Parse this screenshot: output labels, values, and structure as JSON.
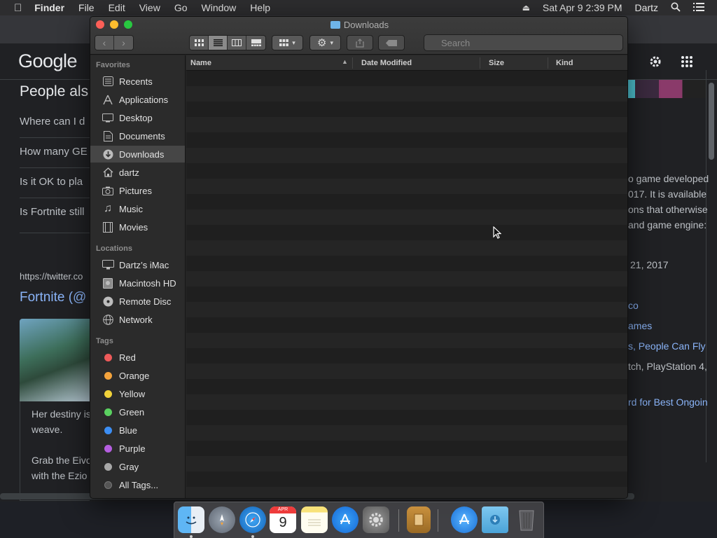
{
  "menubar": {
    "app": "Finder",
    "items": [
      "File",
      "Edit",
      "View",
      "Go",
      "Window",
      "Help"
    ],
    "datetime": "Sat Apr 9  2:39 PM",
    "user": "Dartz"
  },
  "browser": {
    "logo": "Google",
    "people_also": "People als",
    "questions": [
      "Where can I d",
      "How many GE",
      "Is it OK to pla",
      "Is Fortnite still"
    ],
    "url": "https://twitter.co",
    "tweet_title": "Fortnite (@",
    "card_text1": "Her destiny is",
    "card_text2": "weave.",
    "card_text3": "Grab the Eivo",
    "card_text4": "with the Ezio",
    "right_lines": [
      "o game developed",
      "017. It is available",
      "ons that otherwise",
      "and game engine:",
      "21, 2017",
      "co",
      "ames",
      "s, People Can Fly",
      "tch, PlayStation 4,",
      "rd for Best Ongoin"
    ]
  },
  "finder": {
    "window_title": "Downloads",
    "search_placeholder": "Search",
    "columns": {
      "name": "Name",
      "date": "Date Modified",
      "size": "Size",
      "kind": "Kind"
    },
    "sidebar": {
      "favorites_header": "Favorites",
      "favorites": [
        "Recents",
        "Applications",
        "Desktop",
        "Documents",
        "Downloads",
        "dartz",
        "Pictures",
        "Music",
        "Movies"
      ],
      "selected": "Downloads",
      "locations_header": "Locations",
      "locations": [
        "Dartz’s iMac",
        "Macintosh HD",
        "Remote Disc",
        "Network"
      ],
      "tags_header": "Tags",
      "tags": [
        {
          "label": "Red",
          "color": "#ee5a5a"
        },
        {
          "label": "Orange",
          "color": "#f4a33c"
        },
        {
          "label": "Yellow",
          "color": "#f1d23a"
        },
        {
          "label": "Green",
          "color": "#5ad160"
        },
        {
          "label": "Blue",
          "color": "#3c8ef4"
        },
        {
          "label": "Purple",
          "color": "#b55ee0"
        },
        {
          "label": "Gray",
          "color": "#a8a8a8"
        }
      ],
      "all_tags": "All Tags..."
    }
  },
  "dock": {
    "calendar_month": "APR",
    "calendar_day": "9"
  }
}
